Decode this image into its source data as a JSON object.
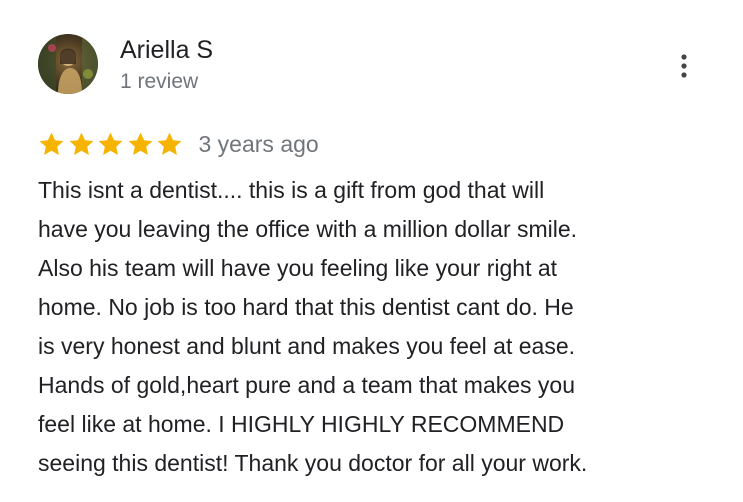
{
  "reviewer": {
    "name": "Ariella S",
    "meta": "1 review",
    "avatar_icon": "user-photo-avatar"
  },
  "rating": {
    "stars": 5,
    "max_stars": 5,
    "star_color": "#f6b400",
    "date": "3 years ago"
  },
  "review": {
    "lines": [
      "This isnt a dentist.... this is a gift from god that will",
      "have you leaving the office with a million dollar smile.",
      "Also his team will have you feeling like your right at",
      "home. No job is too hard that this dentist cant do. He",
      "is very honest and blunt and makes you feel at ease.",
      "Hands of gold,heart pure and a team that makes you",
      "feel like at home. I HIGHLY HIGHLY RECOMMEND",
      "seeing this dentist! Thank you doctor for all your work."
    ]
  },
  "actions": {
    "more_icon": "more-vertical-icon"
  },
  "colors": {
    "text_primary": "#202124",
    "text_secondary": "#70757a",
    "icon": "#444746"
  }
}
